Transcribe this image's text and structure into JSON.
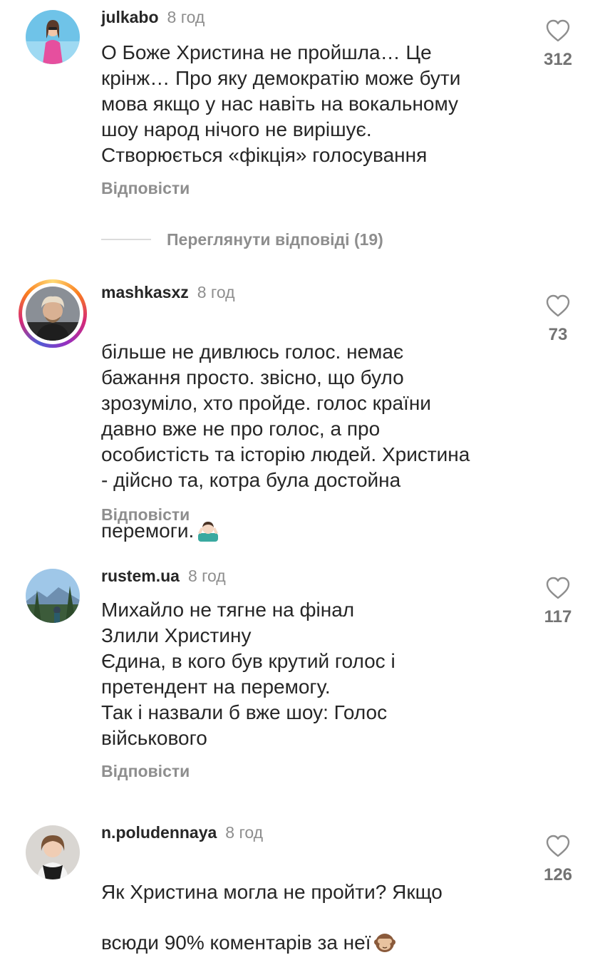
{
  "reply_label": "Відповісти",
  "view_replies": "Переглянути відповіді (19)",
  "comments": [
    {
      "username": "julkabo",
      "time": "8 год",
      "text": "О Боже Христина не пройшла… Це\nкрінж… Про яку демократію може бути\nмова якщо у нас навіть на вокальному\nшоу народ нічого не вирішує.\nСтворюється «фікція» голосування",
      "likes": "312",
      "avatar_icon": "avatar-woman-pink-dress"
    },
    {
      "username": "mashkasxz",
      "time": "8 год",
      "text": "більше не дивлюсь голос. немає\nбажання просто. звісно, що було\nзрозуміло, хто пройде. голос країни\nдавно вже не про голос, а про\nособистість та історію людей. Христина\n- дійсно та, котра була достойна\nперемоги.",
      "emoji": "person-shrugging-emoji",
      "likes": "73",
      "avatar_icon": "avatar-with-story-ring"
    },
    {
      "username": "rustem.ua",
      "time": "8 год",
      "text": "Михайло не тягне на фінал\nЗлили Христину\nЄдина, в кого був крутий голос і\nпретендент на перемогу.\nТак і назвали б вже шоу: Голос\nвійськового",
      "likes": "117",
      "avatar_icon": "avatar-mountain-landscape"
    },
    {
      "username": "n.poludennaya",
      "time": "8 год",
      "text": "Як Христина могла не пройти? Якщо\nвсюди 90% коментарів за неї",
      "emoji": "see-no-evil-monkey-emoji",
      "likes": "126",
      "avatar_icon": "avatar-woman-portrait"
    }
  ],
  "colors": {
    "text": "#262626",
    "muted": "#8e8e8e",
    "divider": "#dbdbdb",
    "heart_stroke": "#8e8e8e"
  }
}
